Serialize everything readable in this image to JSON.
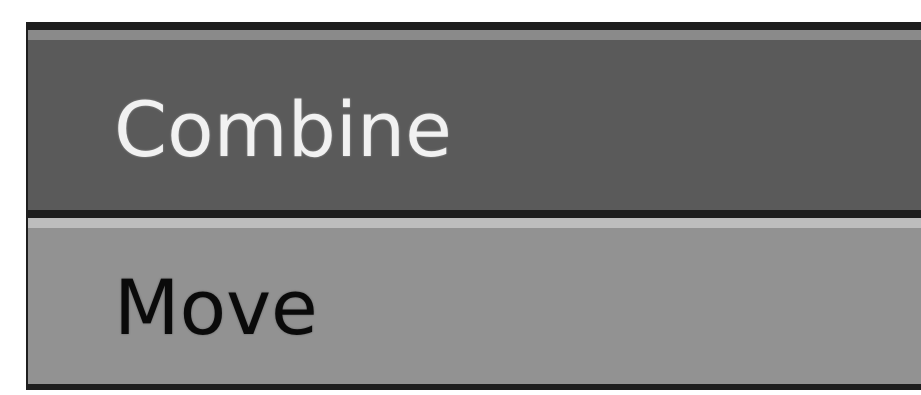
{
  "menu": {
    "items": [
      {
        "label": "Combine",
        "state": "highlighted"
      },
      {
        "label": "Move",
        "state": "normal"
      }
    ]
  },
  "colors": {
    "frame": "#1e1e1e",
    "highlight_bg": "#5a5a5a",
    "highlight_text": "#f1f1f1",
    "normal_bg": "#929292",
    "normal_text": "#0a0a0a"
  }
}
